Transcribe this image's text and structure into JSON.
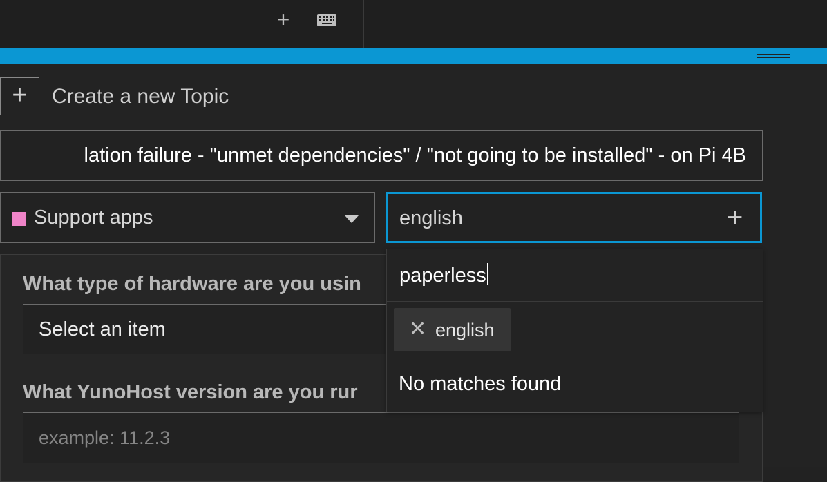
{
  "toolbar": {
    "plus_icon": "plus-icon",
    "keyboard_icon": "keyboard-icon"
  },
  "composer": {
    "create_topic_label": "Create a new Topic",
    "title_value": "lation failure - \"unmet dependencies\" / \"not going to be installed\" - on Pi 4B",
    "category": {
      "label": "Support apps",
      "color": "#ef84c8"
    },
    "tag_chooser": {
      "label": "english"
    },
    "accent_color": "#0b97d3"
  },
  "tag_dropdown": {
    "filter_value": "paperless",
    "selected_tags": [
      {
        "label": "english"
      }
    ],
    "empty_message": "No matches found"
  },
  "form": {
    "q1_label": "What type of hardware are you usin",
    "q1_select_label": "Select an item",
    "q2_label": "What YunoHost version are you rur",
    "q2_placeholder": "example: 11.2.3"
  }
}
